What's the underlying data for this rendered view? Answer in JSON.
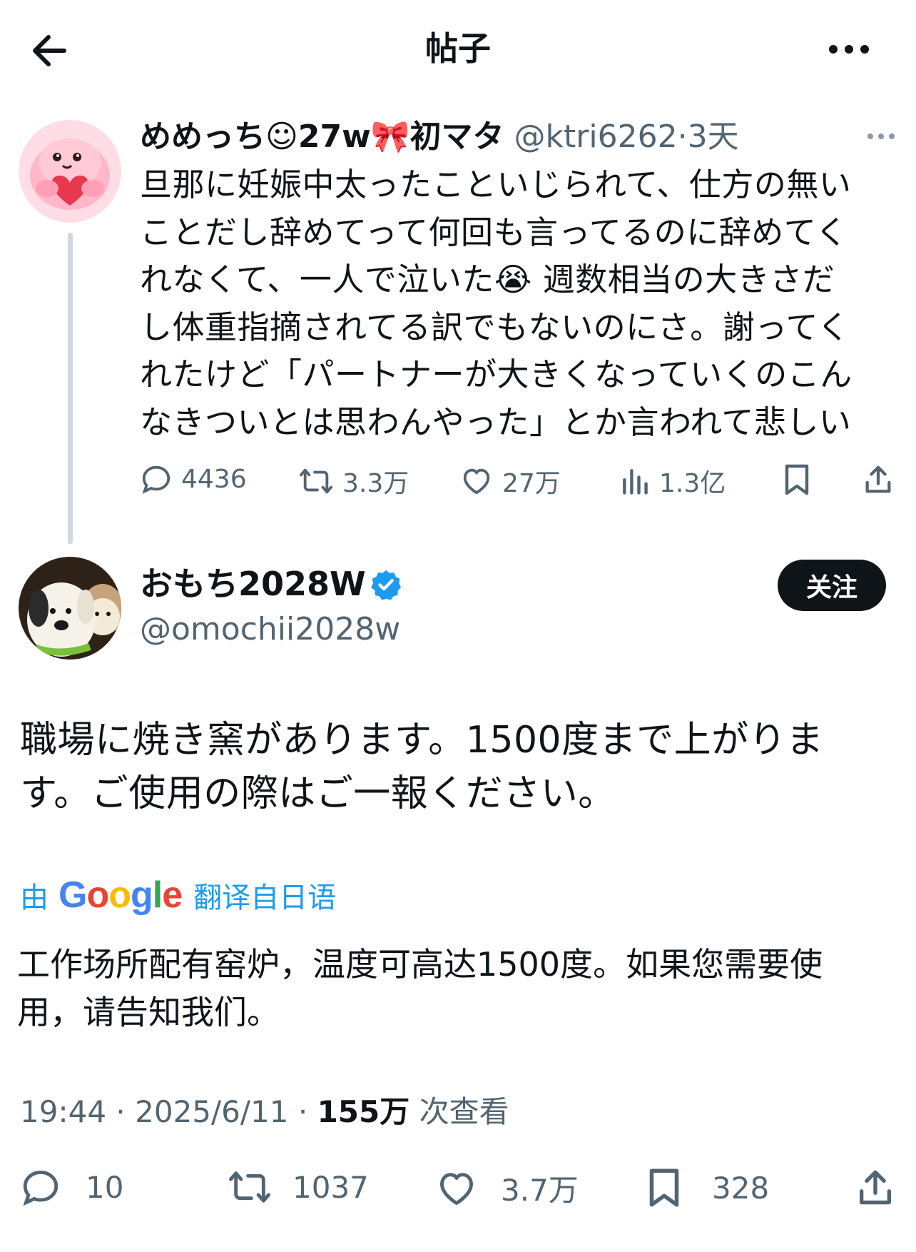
{
  "header": {
    "title": "帖子"
  },
  "parent_tweet": {
    "display_name": "めめっち☺27w🎀初マタ",
    "handle": "@ktri6262",
    "separator": "·",
    "time": "3天",
    "lines": [
      "旦那に妊娠中太ったこといじられて、仕方の無い",
      "ことだし辞めてって何回も言ってるのに辞めてく",
      "れなくて、一人で泣いた😭 週数相当の大きさだ",
      "し体重指摘されてる訳でもないのにさ。謝ってく",
      "れたけど「パートナーが大きくなっていくのこん",
      "なきついとは思わんやった」とか言われて悲しい"
    ],
    "actions": {
      "replies": "4436",
      "retweets": "3.3万",
      "likes": "27万",
      "views": "1.3亿"
    }
  },
  "main_tweet": {
    "display_name": "おもち2028W",
    "handle": "@omochii2028w",
    "follow_label": "关注",
    "lines": [
      "職場に焼き窯があります。1500度まで上がりま",
      "す。ご使用の際はご一報ください。"
    ],
    "translate": {
      "prefix": "由",
      "brand": "Google",
      "link": "翻译自日语"
    },
    "translated_lines": [
      "工作场所配有窑炉，温度可高达1500度。如果您需要使",
      "用，请告知我们。"
    ],
    "meta": {
      "time": "19:44",
      "sep1": "·",
      "date": "2025/6/11",
      "sep2": "·",
      "views_count": "155万",
      "views_label": "次查看"
    },
    "actions": {
      "replies": "10",
      "retweets": "1037",
      "likes": "3.7万",
      "bookmarks": "328"
    }
  },
  "colors": {
    "text": "#0f1419",
    "secondary": "#536471",
    "accent": "#1d9bf0",
    "verified": "#1d9bf0",
    "thread_line": "#cfd9de"
  },
  "icons": [
    "back-arrow-icon",
    "more-icon",
    "reply-icon",
    "retweet-icon",
    "like-icon",
    "views-icon",
    "bookmark-icon",
    "share-icon",
    "verified-badge-icon"
  ]
}
